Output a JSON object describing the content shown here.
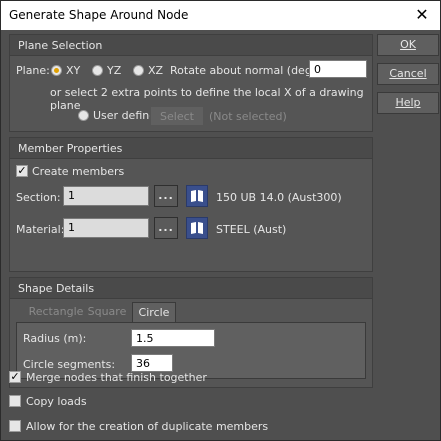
{
  "window": {
    "title": "Generate Shape Around Node",
    "close_glyph": "✕"
  },
  "side_buttons": {
    "ok": "OK",
    "cancel": "Cancel",
    "help": "Help"
  },
  "plane_selection": {
    "header": "Plane Selection",
    "plane_label": "Plane:",
    "options": [
      "XY",
      "YZ",
      "XZ"
    ],
    "selected": "XY",
    "rotate_label": "Rotate about normal (deg):",
    "rotate_value": "0",
    "hint": "or select 2 extra points to define the local X of a drawing plane",
    "user_defined_label": "User defined:",
    "select_button": "Select",
    "not_selected": "(Not selected)"
  },
  "member_properties": {
    "header": "Member Properties",
    "create_members_label": "Create members",
    "create_members_checked": true,
    "section_label": "Section:",
    "section_value": "1",
    "section_desc": "150 UB 14.0 (Aust300)",
    "material_label": "Material:",
    "material_value": "1",
    "material_desc": "STEEL (Aust)",
    "browse_label": "..."
  },
  "shape_details": {
    "header": "Shape Details",
    "tabs": [
      "Rectangle",
      "Square",
      "Circle"
    ],
    "active_tab": "Circle",
    "radius_label": "Radius (m):",
    "radius_value": "1.5",
    "segments_label": "Circle segments:",
    "segments_value": "36"
  },
  "options": {
    "merge_label": "Merge nodes that finish together",
    "merge_checked": true,
    "copy_loads_label": "Copy loads",
    "copy_loads_checked": false,
    "duplicates_label": "Allow for the creation of duplicate members",
    "duplicates_checked": false
  },
  "colors": {
    "background": "#4f4f4f",
    "accent_radio": "#e0a000",
    "book_icon": "#3a4f8c"
  }
}
